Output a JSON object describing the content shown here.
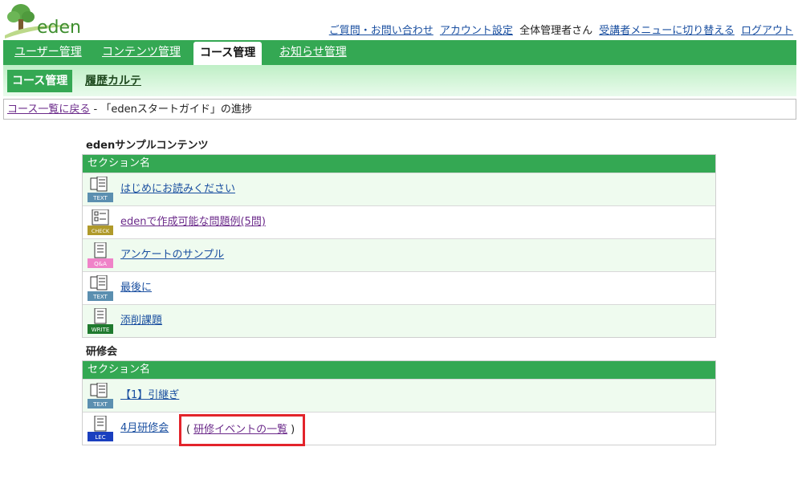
{
  "header": {
    "logo_text": "eden",
    "links": {
      "help": "ご質問・お問い合わせ",
      "account": "アカウント設定",
      "user": "全体管理者さん",
      "switch_menu": "受講者メニューに切り替える",
      "logout": "ログアウト"
    }
  },
  "tabs": [
    {
      "label": "ユーザー管理"
    },
    {
      "label": "コンテンツ管理"
    },
    {
      "label": "コース管理"
    },
    {
      "label": "お知らせ管理"
    }
  ],
  "subtabs": [
    {
      "label": "コース管理"
    },
    {
      "label": "履歴カルテ"
    }
  ],
  "breadcrumb": {
    "back_link": "コース一覧に戻る",
    "separator": " - ",
    "current": "「edenスタートガイド」の進捗"
  },
  "groups": [
    {
      "title": "edenサンプルコンテンツ",
      "header": "セクション名",
      "rows": [
        {
          "icon": "text-icon",
          "badge": "TEXT",
          "label": "はじめにお読みください"
        },
        {
          "icon": "check-icon",
          "badge": "CHECK",
          "label": "edenで作成可能な問題例(5問)"
        },
        {
          "icon": "qa-icon",
          "badge": "Q&A",
          "label": "アンケートのサンプル"
        },
        {
          "icon": "text-icon",
          "badge": "TEXT",
          "label": "最後に"
        },
        {
          "icon": "write-icon",
          "badge": "WRITE",
          "label": "添削課題"
        }
      ]
    },
    {
      "title": "研修会",
      "header": "セクション名",
      "rows": [
        {
          "icon": "text-icon",
          "badge": "TEXT",
          "label": "【1】引継ぎ"
        },
        {
          "icon": "lec-icon",
          "badge": "LEC",
          "label": "4月研修会",
          "extra_open": "(",
          "extra_link": "研修イベントの一覧",
          "extra_close": ")"
        }
      ]
    }
  ],
  "colors": {
    "brand_green": "#34a853",
    "highlight_red": "#e3242b",
    "row_alt": "#effbef"
  }
}
